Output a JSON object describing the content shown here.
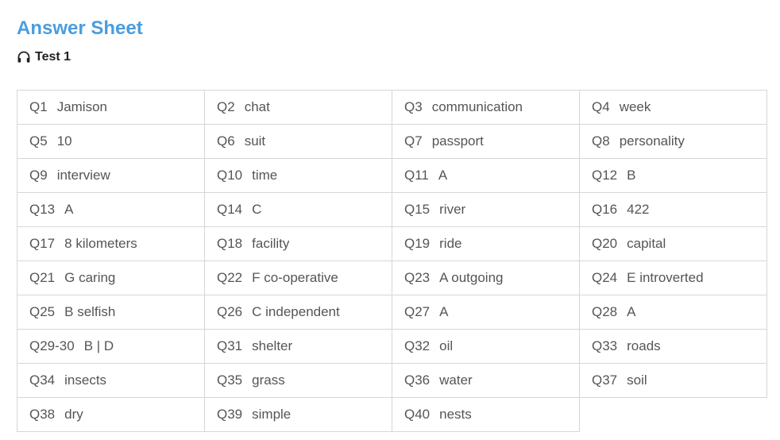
{
  "header": {
    "title": "Answer Sheet",
    "subtitle": "Test 1",
    "subtitle_icon": "headphones-icon"
  },
  "answers": [
    {
      "q": "Q1",
      "a": "Jamison"
    },
    {
      "q": "Q2",
      "a": "chat"
    },
    {
      "q": "Q3",
      "a": "communication"
    },
    {
      "q": "Q4",
      "a": "week"
    },
    {
      "q": "Q5",
      "a": "10"
    },
    {
      "q": "Q6",
      "a": "suit"
    },
    {
      "q": "Q7",
      "a": "passport"
    },
    {
      "q": "Q8",
      "a": "personality"
    },
    {
      "q": "Q9",
      "a": "interview"
    },
    {
      "q": "Q10",
      "a": "time"
    },
    {
      "q": "Q11",
      "a": "A"
    },
    {
      "q": "Q12",
      "a": "B"
    },
    {
      "q": "Q13",
      "a": "A"
    },
    {
      "q": "Q14",
      "a": "C"
    },
    {
      "q": "Q15",
      "a": "river"
    },
    {
      "q": "Q16",
      "a": "422"
    },
    {
      "q": "Q17",
      "a": "8 kilometers"
    },
    {
      "q": "Q18",
      "a": "facility"
    },
    {
      "q": "Q19",
      "a": "ride"
    },
    {
      "q": "Q20",
      "a": "capital"
    },
    {
      "q": "Q21",
      "a": "G caring"
    },
    {
      "q": "Q22",
      "a": "F co-operative"
    },
    {
      "q": "Q23",
      "a": "A outgoing"
    },
    {
      "q": "Q24",
      "a": "E introverted"
    },
    {
      "q": "Q25",
      "a": "B selfish"
    },
    {
      "q": "Q26",
      "a": "C independent"
    },
    {
      "q": "Q27",
      "a": "A"
    },
    {
      "q": "Q28",
      "a": "A"
    },
    {
      "q": "Q29-30",
      "a": "B | D"
    },
    {
      "q": "Q31",
      "a": "shelter"
    },
    {
      "q": "Q32",
      "a": "oil"
    },
    {
      "q": "Q33",
      "a": "roads"
    },
    {
      "q": "Q34",
      "a": "insects"
    },
    {
      "q": "Q35",
      "a": "grass"
    },
    {
      "q": "Q36",
      "a": "water"
    },
    {
      "q": "Q37",
      "a": "soil"
    },
    {
      "q": "Q38",
      "a": "dry"
    },
    {
      "q": "Q39",
      "a": "simple"
    },
    {
      "q": "Q40",
      "a": "nests"
    }
  ]
}
